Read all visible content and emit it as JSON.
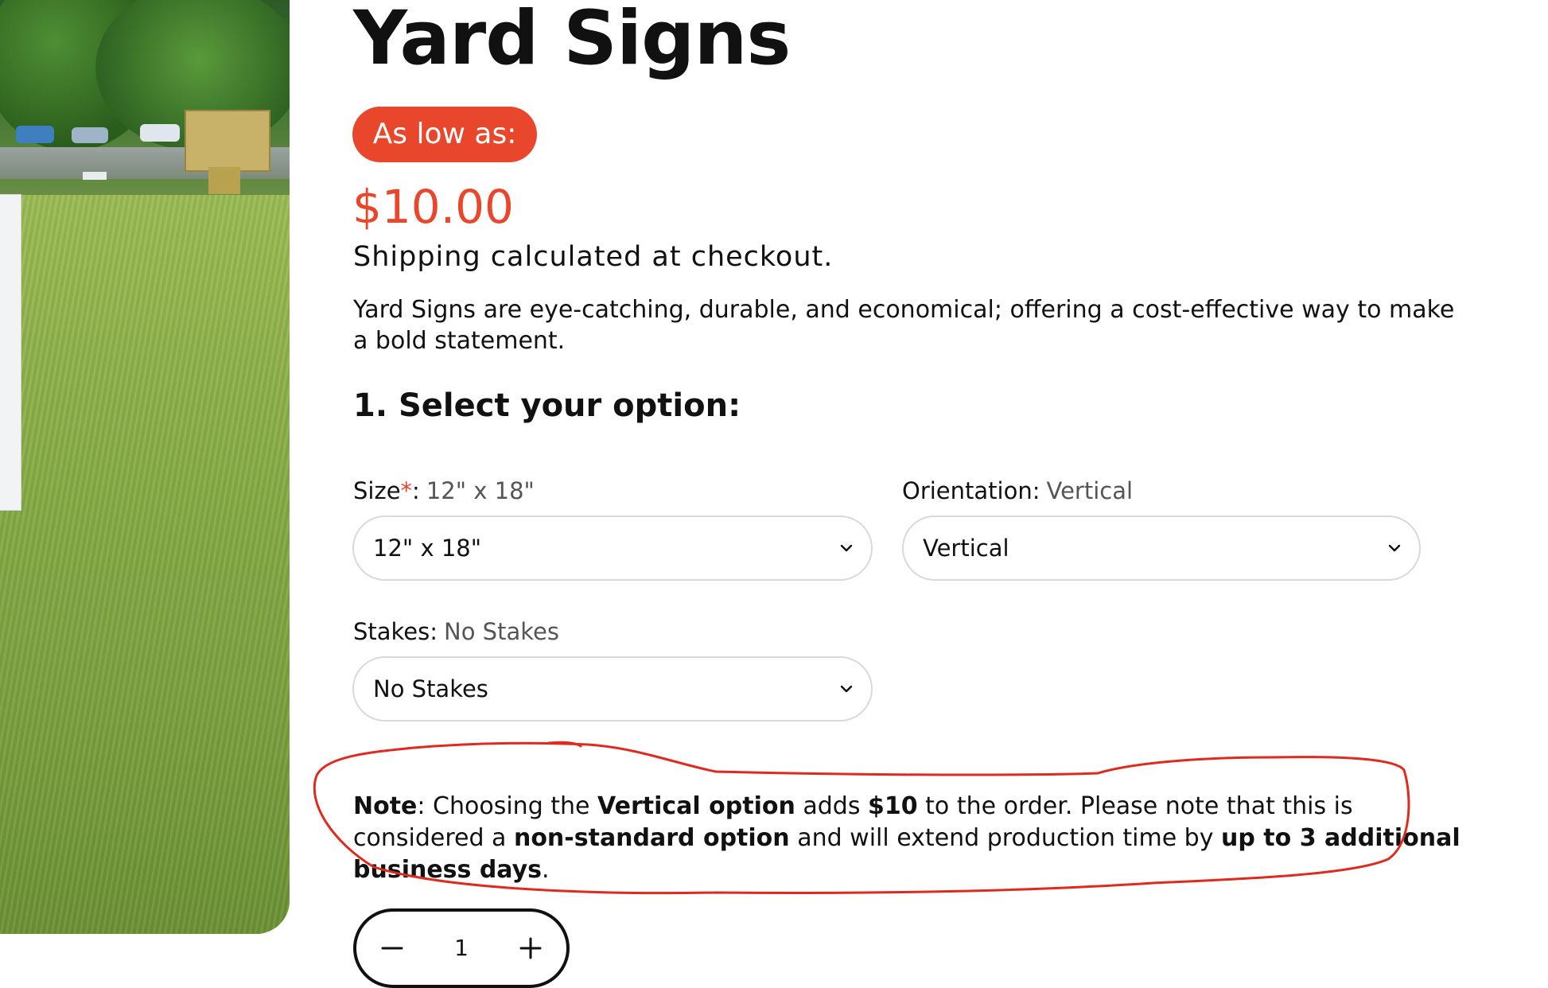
{
  "product": {
    "title": "Yard Signs",
    "badge": "As low as:",
    "price": "$10.00",
    "shipping": "Shipping calculated at checkout.",
    "description": "Yard Signs are eye-catching, durable, and economical; offering a cost-effective way to make a bold statement."
  },
  "options": {
    "heading": "1. Select your option:",
    "size": {
      "label": "Size",
      "required_mark": "*",
      "colon": ":",
      "current": "12\" x 18\"",
      "selected": "12\" x 18\""
    },
    "orientation": {
      "label": "Orientation:",
      "current": "Vertical",
      "selected": "Vertical"
    },
    "stakes": {
      "label": "Stakes:",
      "current": "No Stakes",
      "selected": "No Stakes"
    }
  },
  "note": {
    "prefix_bold": "Note",
    "t1": ": Choosing the ",
    "b1": "Vertical option",
    "t2": " adds ",
    "b2": "$10",
    "t3": " to the order. Please note that this is considered a ",
    "b3": "non-standard option",
    "t4": " and will extend production time by ",
    "b4": "up to 3 additional business days",
    "t5": "."
  },
  "quantity": {
    "value": "1"
  },
  "colors": {
    "accent": "#e8472b",
    "annotation": "#e02a1e",
    "text": "#111111",
    "border": "#d9d9d9"
  },
  "icons": {
    "select_arrow": "chevron-down-icon",
    "decrease": "minus-icon",
    "increase": "plus-icon"
  }
}
